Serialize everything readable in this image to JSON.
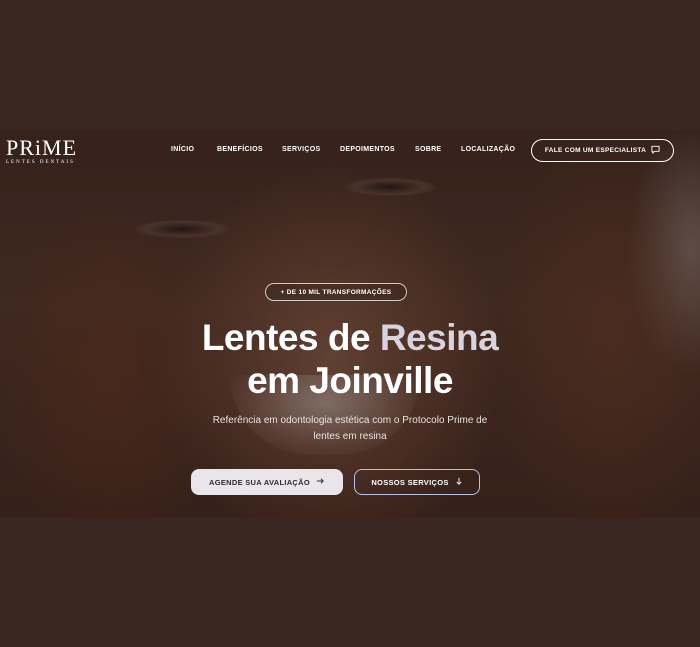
{
  "logo": {
    "main": "PRiME",
    "sub": "LENTES DENTAIS"
  },
  "nav": {
    "items": [
      {
        "label": "INÍCIO"
      },
      {
        "label": "BENEFÍCIOS"
      },
      {
        "label": "SERVIÇOS"
      },
      {
        "label": "DEPOIMENTOS"
      },
      {
        "label": "SOBRE"
      },
      {
        "label": "LOCALIZAÇÃO"
      }
    ],
    "cta_label": "FALE COM UM ESPECIALISTA",
    "cta_icon": "chat-icon"
  },
  "hero": {
    "badge": "+ DE 10 MIL TRANSFORMAÇÕES",
    "title_line1_part1": "Lentes de ",
    "title_line1_accent": "Resina",
    "title_line2": "em Joinville",
    "subtitle_line1": "Referência em odontologia estética com o Protocolo Prime de",
    "subtitle_line2": "lentes em resina",
    "primary_button": "AGENDE SUA AVALIAÇÃO",
    "primary_icon": "arrow-right-icon",
    "secondary_button": "NOSSOS SERVIÇOS",
    "secondary_icon": "arrow-down-icon"
  },
  "colors": {
    "page_bg": "#3b2722",
    "accent_text": "#d8d3dc",
    "primary_button_bg": "#e8e6ea",
    "secondary_border": "#b8c0e8"
  }
}
